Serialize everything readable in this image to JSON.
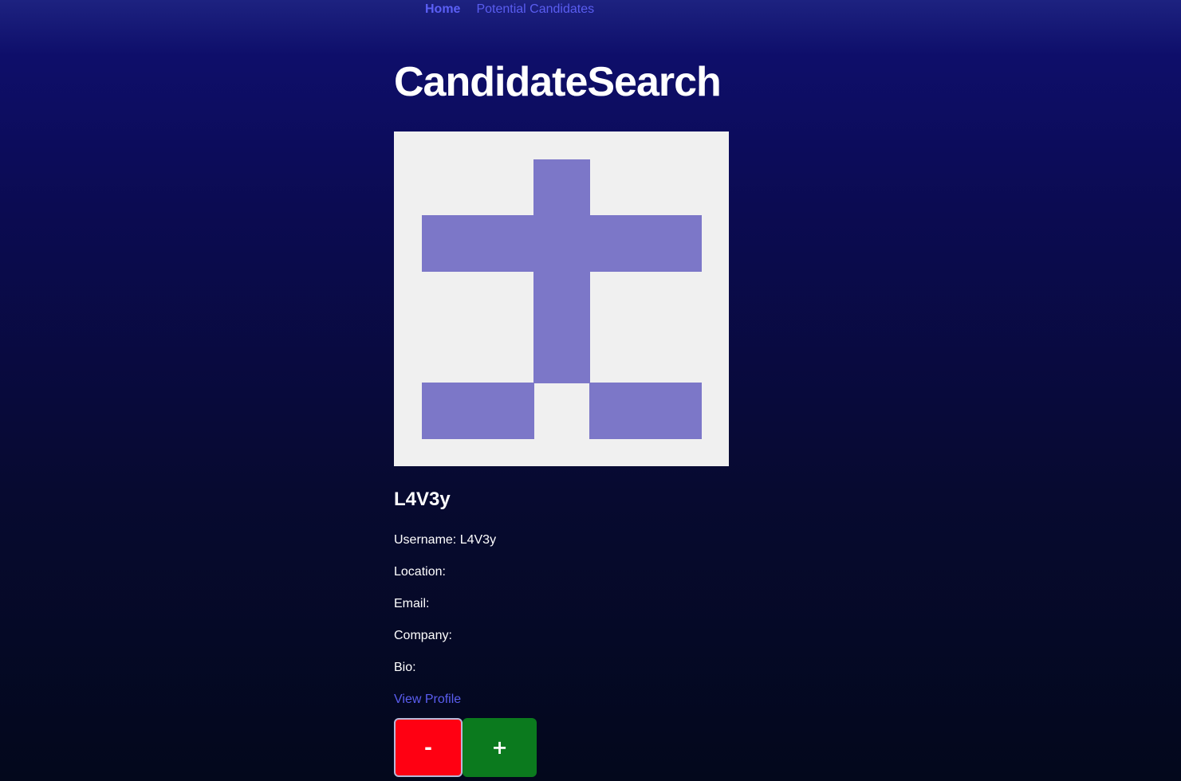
{
  "nav": {
    "home_label": "Home",
    "potential_label": "Potential Candidates"
  },
  "page": {
    "title": "CandidateSearch"
  },
  "candidate": {
    "name": "L4V3y",
    "username_line": "Username: L4V3y",
    "location_line": "Location:",
    "email_line": "Email:",
    "company_line": "Company:",
    "bio_line": "Bio:",
    "profile_link_label": "View Profile",
    "avatar_color": "#7c77c8",
    "avatar_bg": "#f0f0f0"
  },
  "actions": {
    "reject_label": "-",
    "accept_label": "+",
    "reject_color": "#ff0012",
    "accept_color": "#0b7a1e"
  },
  "colors": {
    "link": "#5a5df0",
    "text": "#ffffff"
  }
}
